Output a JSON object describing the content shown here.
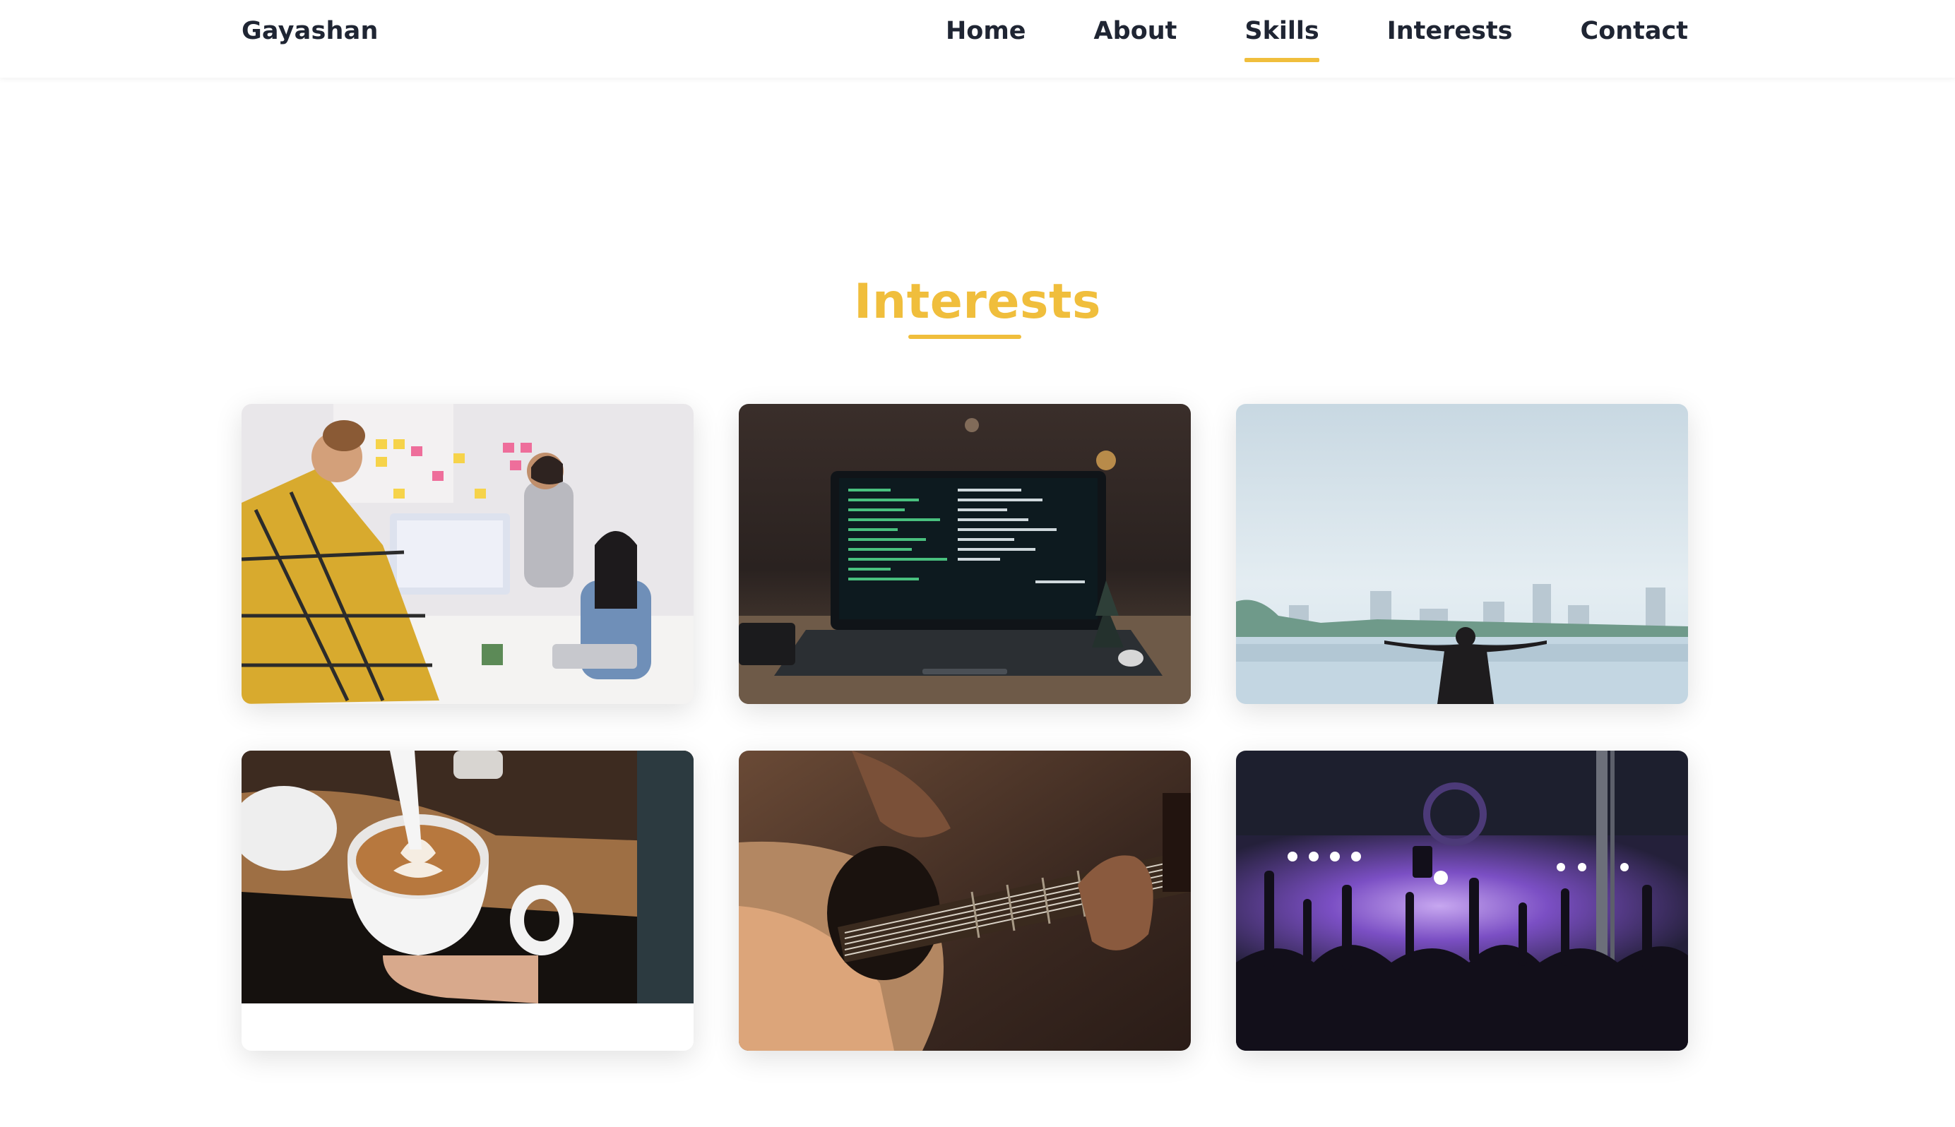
{
  "navbar": {
    "brand": "Gayashan",
    "links": [
      {
        "label": "Home"
      },
      {
        "label": "About"
      },
      {
        "label": "Skills",
        "active": true
      },
      {
        "label": "Interests"
      },
      {
        "label": "Contact"
      }
    ]
  },
  "section": {
    "title": "Interests"
  },
  "colors": {
    "accent": "#f0be3c",
    "text": "#1f2533",
    "background": "#ffffff"
  },
  "cards": [
    {
      "image": "team-meeting-photo"
    },
    {
      "image": "laptop-code-photo"
    },
    {
      "image": "lake-city-photo"
    },
    {
      "image": "latte-art-photo"
    },
    {
      "image": "acoustic-guitar-photo"
    },
    {
      "image": "concert-crowd-photo"
    }
  ]
}
